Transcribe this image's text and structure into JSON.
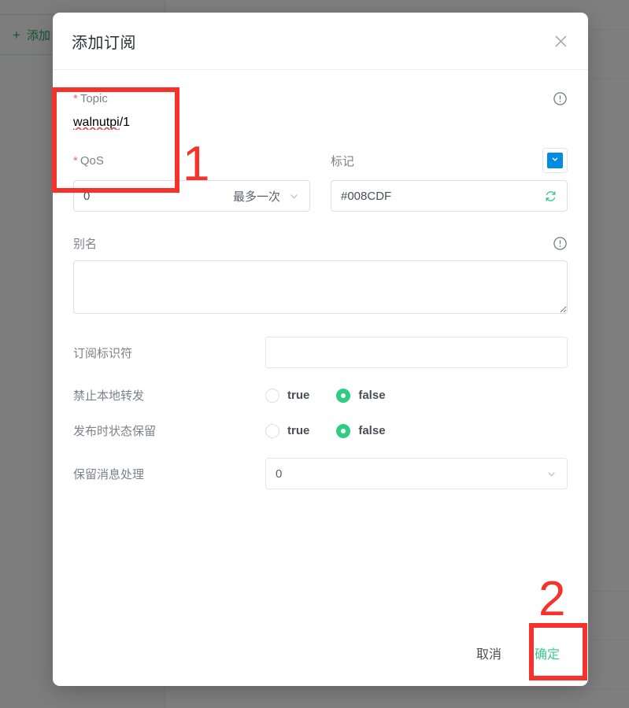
{
  "background": {
    "add_button_label": "添加",
    "add_button_icon": "plus-icon"
  },
  "modal": {
    "title": "添加订阅",
    "close_icon": "close-icon",
    "topic": {
      "label": "Topic",
      "required_mark": "*",
      "info_icon": "info-circle-icon",
      "value_main": "walnutpi",
      "value_suffix": "/1",
      "placeholder": ""
    },
    "qos": {
      "label": "QoS",
      "required_mark": "*",
      "value": "0",
      "option_text": "最多一次",
      "chevron_icon": "chevron-down-icon"
    },
    "tag": {
      "label": "标记",
      "swatch_color": "#008CDF",
      "swatch_chevron_icon": "chevron-down-icon",
      "value": "#008CDF",
      "refresh_icon": "refresh-icon"
    },
    "alias": {
      "label": "别名",
      "info_icon": "info-circle-icon",
      "value": "",
      "placeholder": ""
    },
    "sub_identifier": {
      "label": "订阅标识符",
      "value": "",
      "placeholder": ""
    },
    "no_local": {
      "label": "禁止本地转发",
      "options": [
        {
          "label": "true",
          "checked": false
        },
        {
          "label": "false",
          "checked": true
        }
      ]
    },
    "retain_as_published": {
      "label": "发布时状态保留",
      "options": [
        {
          "label": "true",
          "checked": false
        },
        {
          "label": "false",
          "checked": true
        }
      ]
    },
    "retain_handling": {
      "label": "保留消息处理",
      "value": "0",
      "chevron_icon": "chevron-down-icon"
    },
    "footer": {
      "cancel_label": "取消",
      "confirm_label": "确定"
    }
  },
  "annotations": {
    "one": "1",
    "two": "2"
  },
  "colors": {
    "accent_green": "#2ecc84",
    "confirm_green": "#3ec98e",
    "required_red": "#ef6a6a",
    "annotation_red": "#f5322c",
    "tag_blue": "#008CDF"
  }
}
